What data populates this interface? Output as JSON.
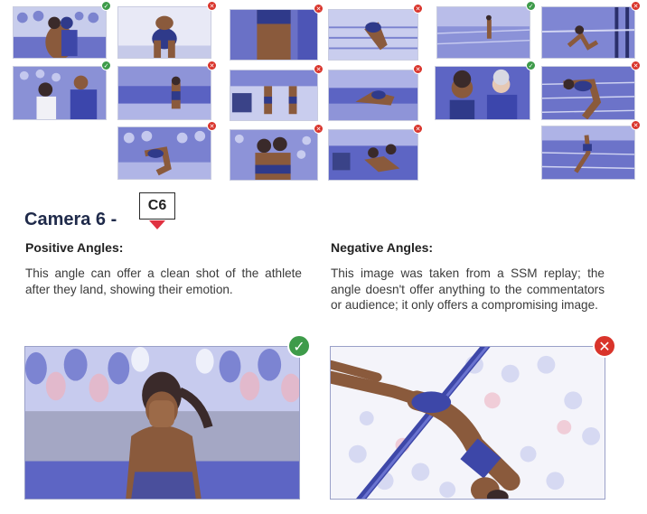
{
  "camera": {
    "title": "Camera 6 -",
    "tag": "C6"
  },
  "positive": {
    "heading": "Positive Angles:",
    "text": "This angle can offer a clean shot of the athlete after they land, showing their emotion.",
    "status": "approved"
  },
  "negative": {
    "heading": "Negative Angles:",
    "text": "This image was taken from a SSM replay; the angle doesn't offer anything to the commentators or audience; it only offers a compromising image.",
    "status": "rejected"
  },
  "thumbnails": [
    {
      "status": "approved",
      "scene": "athlete-hugging-crowd"
    },
    {
      "status": "rejected",
      "scene": "athlete-bending-closeup"
    },
    {
      "status": "rejected",
      "scene": "athlete-back-closeup"
    },
    {
      "status": "rejected",
      "scene": "athlete-crouching-track"
    },
    {
      "status": "approved",
      "scene": "athlete-far-stadium"
    },
    {
      "status": "rejected",
      "scene": "athlete-sitting-bar"
    },
    {
      "status": "approved",
      "scene": "athlete-with-coach"
    },
    {
      "status": "rejected",
      "scene": "athlete-standing-crowd"
    },
    {
      "status": "rejected",
      "scene": "two-athletes-walking"
    },
    {
      "status": "rejected",
      "scene": "athlete-on-mat"
    },
    {
      "status": "approved",
      "scene": "athlete-celebrating-coach"
    },
    {
      "status": "rejected",
      "scene": "athlete-bending-track"
    },
    {
      "status": "rejected",
      "scene": "athlete-bending-crowd"
    },
    {
      "status": "rejected",
      "scene": "athletes-embracing"
    },
    {
      "status": "rejected",
      "scene": "athletes-sitting-track"
    },
    {
      "status": "rejected",
      "scene": "athlete-jumping-overhead"
    }
  ],
  "colors": {
    "approved": "#3e9b4a",
    "rejected": "#d9342b",
    "illustration_blue": "#5b63c4",
    "skin": "#8a5a3c"
  },
  "icons": {
    "approved": "check-circle-icon",
    "rejected": "x-circle-icon"
  }
}
